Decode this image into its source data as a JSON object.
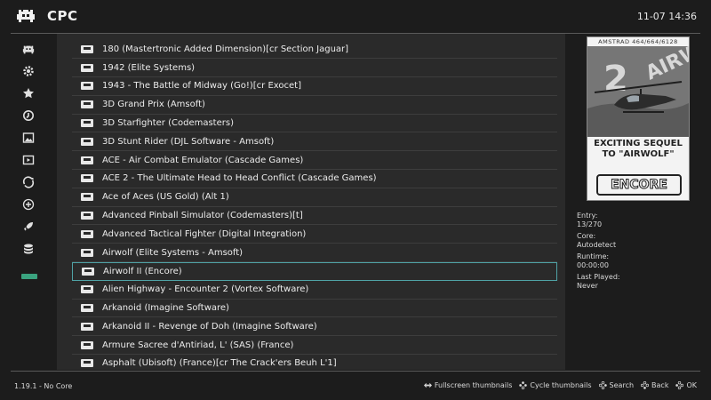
{
  "header": {
    "title": "CPC",
    "clock": "11-07 14:36"
  },
  "sidebar": {
    "icons": [
      "retroarch-logo-icon",
      "gear-icon",
      "star-icon",
      "history-icon",
      "image-icon",
      "video-icon",
      "netplay-icon",
      "add-icon",
      "rocket-icon",
      "database-icon",
      "playlist-active-icon"
    ]
  },
  "list": {
    "items": [
      "180 (Mastertronic Added Dimension)[cr Section Jaguar]",
      "1942 (Elite Systems)",
      "1943 - The Battle of Midway (Go!)[cr Exocet]",
      "3D Grand Prix (Amsoft)",
      "3D Starfighter (Codemasters)",
      "3D Stunt Rider (DJL Software - Amsoft)",
      "ACE - Air Combat Emulator (Cascade Games)",
      "ACE 2 - The Ultimate Head to Head Conflict (Cascade Games)",
      "Ace of Aces (US Gold) (Alt 1)",
      "Advanced Pinball Simulator (Codemasters)[t]",
      "Advanced Tactical Fighter (Digital Integration)",
      "Airwolf (Elite Systems - Amsoft)",
      "Airwolf II (Encore)",
      "Alien Highway - Encounter 2 (Vortex Software)",
      "Arkanoid (Imagine Software)",
      "Arkanoid II - Revenge of Doh (Imagine Software)",
      "Armure Sacree d'Antiriad, L' (SAS) (France)",
      "Asphalt (Ubisoft) (France)[cr The Crack'ers Beuh L'1]"
    ],
    "selected_index": 12
  },
  "boxart": {
    "top_band": "AMSTRAD 464/664/6128",
    "tagline": "EXCITING SEQUEL TO \"AIRWOLF\"",
    "brand": "ENCORE"
  },
  "info": {
    "entry_label": "Entry:",
    "entry_value": "13/270",
    "core_label": "Core:",
    "core_value": "Autodetect",
    "runtime_label": "Runtime:",
    "runtime_value": "00:00:00",
    "last_played_label": "Last Played:",
    "last_played_value": "Never"
  },
  "footer": {
    "version": "1.19.1 - No Core",
    "hints": {
      "fullscreen": "Fullscreen thumbnails",
      "cycle": "Cycle thumbnails",
      "search": "Search",
      "back": "Back",
      "ok": "OK"
    }
  },
  "colors": {
    "background": "#1c1c1c",
    "list_background": "#2a2a2a",
    "selection_border": "#4fa3a6",
    "active_playlist": "#3aa37f"
  }
}
